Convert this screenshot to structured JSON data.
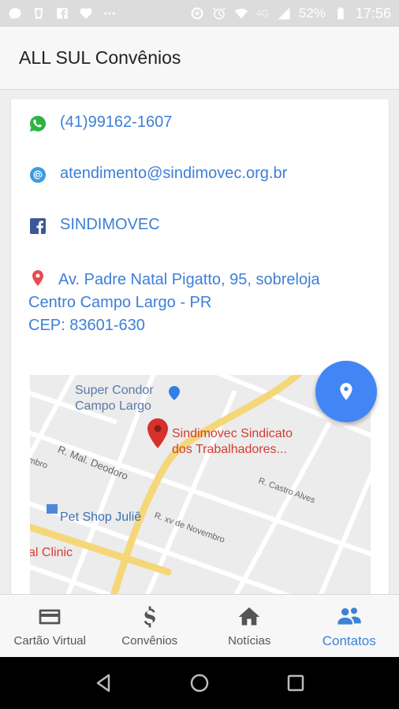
{
  "status_bar": {
    "network": "4G",
    "battery": "52%",
    "time": "17:56",
    "left_icons": [
      "messenger-icon",
      "cup-icon",
      "facebook-icon",
      "heart-icon",
      "more-icon"
    ],
    "right_icons": [
      "data-saver-icon",
      "alarm-icon",
      "wifi-icon",
      "signal-icon",
      "battery-icon"
    ]
  },
  "app_bar": {
    "title": "ALL SUL Convênios"
  },
  "contacts": {
    "whatsapp": {
      "icon": "whatsapp-icon",
      "text": "(41)99162-1607",
      "color": "#2fb344"
    },
    "email": {
      "icon": "at-icon",
      "text": "atendimento@sindimovec.org.br",
      "color": "#3d9be0"
    },
    "facebook": {
      "icon": "facebook-icon",
      "text": "SINDIMOVEC",
      "color": "#3b5998"
    },
    "address": {
      "icon": "map-pin-icon",
      "line1": "Av. Padre Natal Pigatto, 95, sobreloja",
      "line2": "Centro Campo Largo - PR",
      "line3": "CEP: 83601-630",
      "color": "#e94b4b"
    },
    "link_color": "#3d7fd6"
  },
  "map": {
    "store_label_1": "Super Condor",
    "store_label_2": "Campo Largo",
    "place_label_1": "Sindimovec Sindicato",
    "place_label_2": "dos Trabalhadores...",
    "street_1": "R. Mal. Deodoro",
    "street_2": "R. Castro Alves",
    "street_3": "R. xv de Novembro",
    "street_4": "mbro",
    "pet_shop": "Pet Shop Juliê",
    "clinic": "al Clinic",
    "fab_icon": "location-pin-icon",
    "fab_color": "#4285f4"
  },
  "tabs": [
    {
      "label": "Cartão Virtual",
      "icon": "credit-card-icon",
      "active": false
    },
    {
      "label": "Convênios",
      "icon": "dollar-icon",
      "active": false
    },
    {
      "label": "Notícias",
      "icon": "home-icon",
      "active": false
    },
    {
      "label": "Contatos",
      "icon": "contacts-icon",
      "active": true
    }
  ],
  "nav_bar": {
    "buttons": [
      "back-icon",
      "home-circle-icon",
      "recents-icon"
    ]
  }
}
